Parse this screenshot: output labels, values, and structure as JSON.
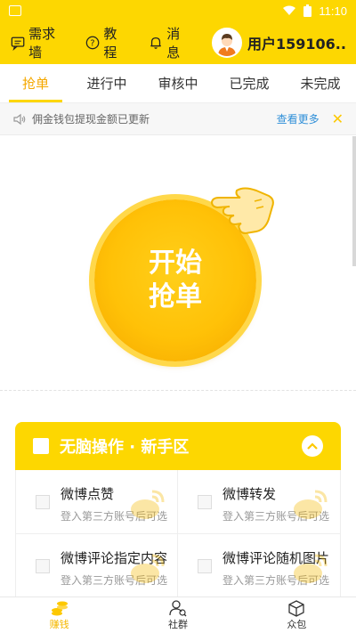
{
  "status_bar": {
    "time": "11:10"
  },
  "header": {
    "items": [
      {
        "label": "需求墙",
        "icon": "chat-icon"
      },
      {
        "label": "教程",
        "icon": "question-icon"
      },
      {
        "label": "消息",
        "icon": "bell-icon"
      }
    ],
    "user_name": "用户159106..."
  },
  "tabs": [
    "抢单",
    "进行中",
    "审核中",
    "已完成",
    "未完成"
  ],
  "active_tab": 0,
  "notice": {
    "text": "佣金钱包提现金额已更新",
    "more": "查看更多"
  },
  "grab_button": {
    "line1": "开始",
    "line2": "抢单"
  },
  "section": {
    "title": "无脑操作 · 新手区",
    "tasks": [
      {
        "title": "微博点赞",
        "subtitle": "登入第三方账号后可选"
      },
      {
        "title": "微博转发",
        "subtitle": "登入第三方账号后可选"
      },
      {
        "title": "微博评论指定内容",
        "subtitle": "登入第三方账号后可选"
      },
      {
        "title": "微博评论随机图片",
        "subtitle": "登入第三方账号后可选"
      }
    ]
  },
  "bottom_nav": [
    {
      "label": "赚钱",
      "icon": "coins-icon",
      "active": true
    },
    {
      "label": "社群",
      "icon": "community-icon",
      "active": false
    },
    {
      "label": "众包",
      "icon": "box-icon",
      "active": false
    }
  ],
  "colors": {
    "brand": "#fdd701",
    "accent": "#f5a800",
    "link": "#2f8fd8"
  }
}
